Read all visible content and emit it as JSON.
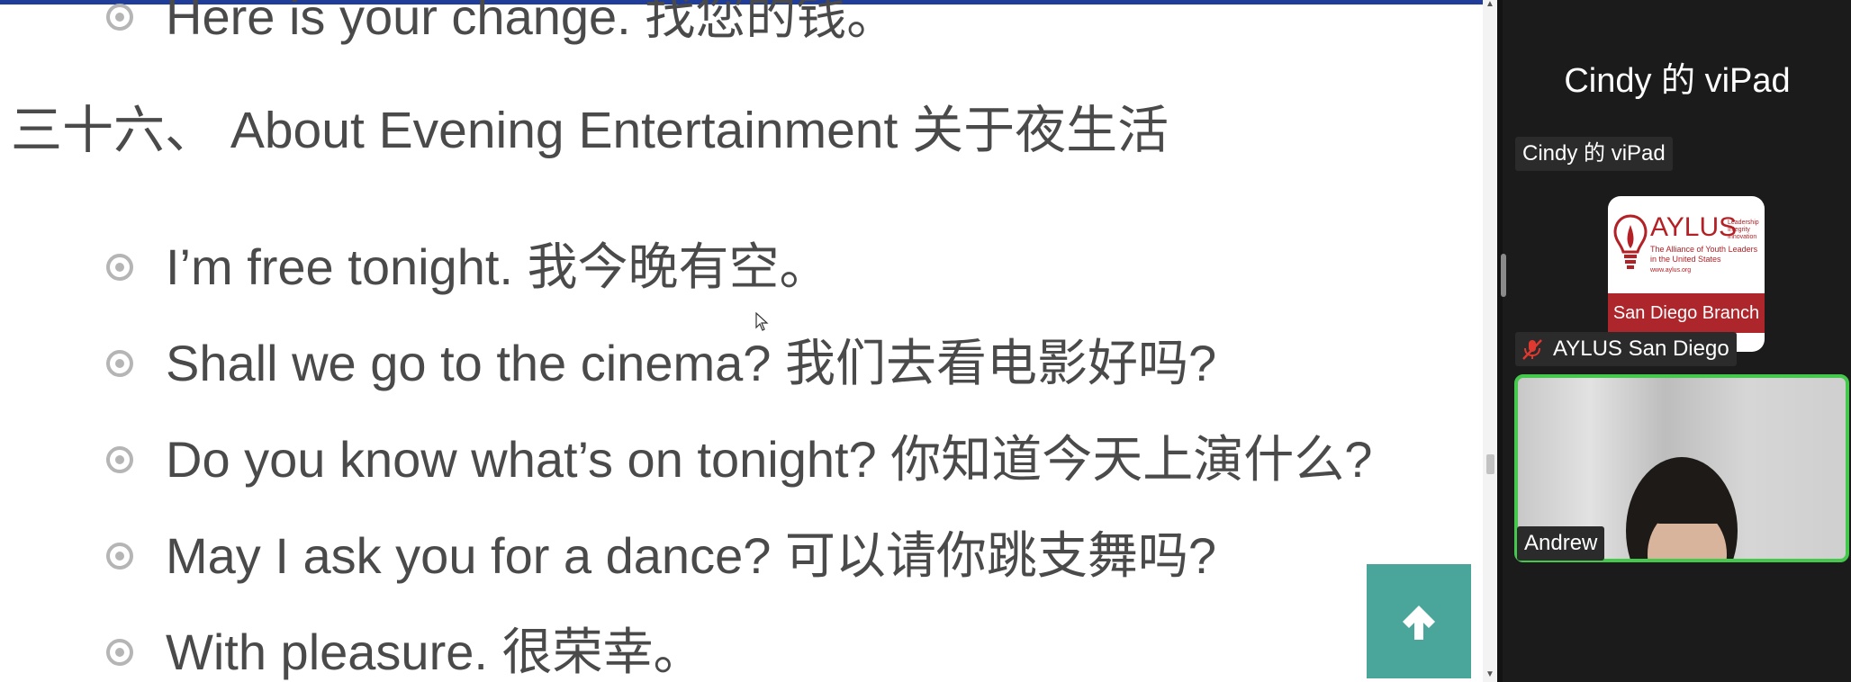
{
  "document": {
    "previous_item": "Here is your change. 找您的钱。",
    "section_heading": "三十六、 About Evening Entertainment 关于夜生活",
    "items": [
      "I’m free tonight. 我今晚有空。",
      "Shall we go to the cinema? 我们去看电影好吗?",
      "Do you know what’s on tonight? 你知道今天上演什么?",
      "May I ask you for a dance? 可以请你跳支舞吗?",
      "With pleasure. 很荣幸。"
    ],
    "back_to_top_icon": "arrow-up-icon",
    "accent_colors": {
      "top_bar": "#1f3d99",
      "back_to_top": "#4aa69a",
      "bullet": "#b5b5b5",
      "text": "#4a4a4a"
    }
  },
  "meeting": {
    "device_title": "Cindy 的 viPad",
    "tiles": [
      {
        "label": "Cindy 的 viPad"
      },
      {
        "label": "AYLUS San Diego",
        "muted_icon": "mic-muted-icon"
      },
      {
        "label": "Andrew",
        "active_speaker": true
      }
    ],
    "aylus_logo": {
      "brand": "AYLUS",
      "side_text": [
        "Leadership",
        "Integrity",
        "Innovation"
      ],
      "subtitle": "The Alliance of Youth Leaders in the United States",
      "url": "www.aylus.org",
      "branch": "San Diego Branch"
    },
    "colors": {
      "panel_bg": "#1b1b1b",
      "speaker_border": "#45c94d",
      "logo_red": "#ad262c"
    }
  }
}
